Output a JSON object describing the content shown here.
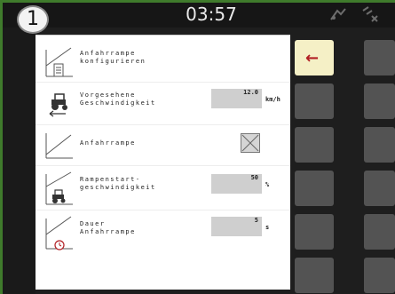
{
  "header": {
    "badge": "1",
    "time": "03:57"
  },
  "rows": [
    {
      "label": "Anfahrrampe\nkonfigurieren",
      "icon": "ramp-config-icon"
    },
    {
      "label": "Vorgesehene\nGeschwindigkeit",
      "value": "12.0",
      "unit": "km/h",
      "icon": "tractor-speed-icon"
    },
    {
      "label": "Anfahrrampe",
      "checkbox": "crossed",
      "icon": "ramp-icon"
    },
    {
      "label": "Rampenstart-\ngeschwindigkeit",
      "value": "50",
      "unit": "%",
      "icon": "ramp-tractor-icon"
    },
    {
      "label": "Dauer\nAnfahrrampe",
      "value": "5",
      "unit": "s",
      "icon": "ramp-clock-icon"
    }
  ],
  "softkeys": {
    "back": "←"
  }
}
